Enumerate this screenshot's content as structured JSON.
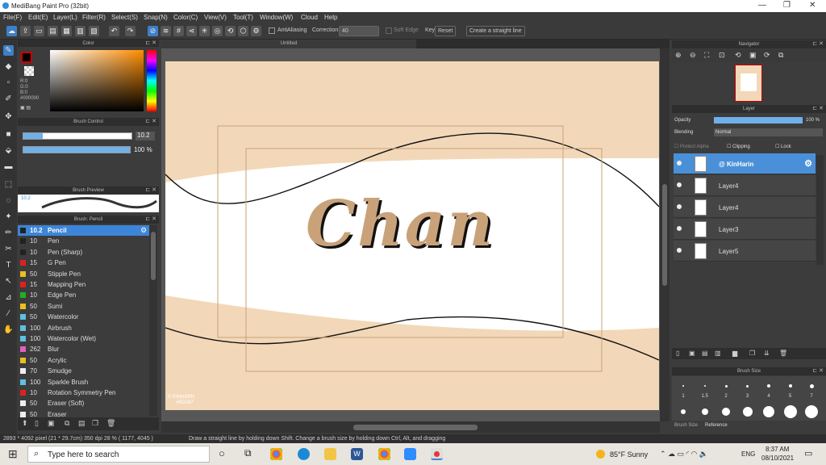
{
  "app": {
    "title": "MediBang Paint Pro (32bit)"
  },
  "menu": [
    "File(F)",
    "Edit(E)",
    "Layer(L)",
    "Filter(R)",
    "Select(S)",
    "Snap(N)",
    "Color(C)",
    "View(V)",
    "Tool(T)",
    "Window(W)",
    "Cloud",
    "Help"
  ],
  "toolbar": {
    "antialiasing": "AntiAliasing",
    "correction": "Correction",
    "correction_value": "40",
    "soft_edge": "Soft Edge",
    "key": "Key",
    "reset": "Reset",
    "straight_line": "Create a straight line"
  },
  "color_panel": {
    "title": "Color",
    "r": "R:0",
    "g": "G:0",
    "b": "B:0",
    "hex": "#000000"
  },
  "brush_control": {
    "title": "Brush Control",
    "size": "10.2",
    "opacity": "100 %"
  },
  "brush_preview": {
    "title": "Brush Preview",
    "size_label": "10.2"
  },
  "brush_list": {
    "title": "Brush: Pencil",
    "items": [
      {
        "size": "10.2",
        "name": "Pencil",
        "color": "#222222"
      },
      {
        "size": "10",
        "name": "Pen",
        "color": "#222222"
      },
      {
        "size": "10",
        "name": "Pen (Sharp)",
        "color": "#222222"
      },
      {
        "size": "15",
        "name": "G Pen",
        "color": "#e02020"
      },
      {
        "size": "50",
        "name": "Stipple Pen",
        "color": "#e8c020"
      },
      {
        "size": "15",
        "name": "Mapping Pen",
        "color": "#e02020"
      },
      {
        "size": "10",
        "name": "Edge Pen",
        "color": "#20b020"
      },
      {
        "size": "50",
        "name": "Sumi",
        "color": "#e8c020"
      },
      {
        "size": "50",
        "name": "Watercolor",
        "color": "#60c0e0"
      },
      {
        "size": "100",
        "name": "Airbrush",
        "color": "#60c0e0"
      },
      {
        "size": "100",
        "name": "Watercolor (Wet)",
        "color": "#60c0e0"
      },
      {
        "size": "262",
        "name": "Blur",
        "color": "#e060c0"
      },
      {
        "size": "50",
        "name": "Acrylic",
        "color": "#e8c020"
      },
      {
        "size": "70",
        "name": "Smudge",
        "color": "#eeeeee"
      },
      {
        "size": "100",
        "name": "Sparkle Brush",
        "color": "#60c0e0"
      },
      {
        "size": "10",
        "name": "Rotation Symmetry Pen",
        "color": "#e02020"
      },
      {
        "size": "50",
        "name": "Eraser (Soft)",
        "color": "#eeeeee"
      },
      {
        "size": "50",
        "name": "Eraser",
        "color": "#eeeeee"
      }
    ]
  },
  "canvas": {
    "tab": "Untitled",
    "lettering": "Chan",
    "watermark_line1": "© KINHARN",
    "watermark_line2": "#KD247"
  },
  "navigator": {
    "title": "Navigator"
  },
  "layer_panel": {
    "title": "Layer",
    "opacity_label": "Opacity",
    "opacity_value": "100 %",
    "blending_label": "Blending",
    "blending_value": "Normal",
    "protect_alpha": "Protect Alpha",
    "clipping": "Clipping",
    "lock": "Lock",
    "layers": [
      {
        "name": "@ KinHarin"
      },
      {
        "name": "Layer4"
      },
      {
        "name": "Layer4"
      },
      {
        "name": "Layer3"
      },
      {
        "name": "Layer5"
      }
    ]
  },
  "brush_size": {
    "title": "Brush Size",
    "labels": [
      "1",
      "1.5",
      "2",
      "3",
      "4",
      "5",
      "7"
    ],
    "tab1": "Brush Size",
    "tab2": "Reference"
  },
  "status": {
    "dims": "2893 * 4092 pixel  (21 * 29.7cm)  350 dpi  28 %  ( 1177, 4045 )",
    "hint": "Draw a straight line by holding down Shift. Change a brush size by holding down Ctrl, Alt, and dragging"
  },
  "taskbar": {
    "search": "Type here to search",
    "weather": "85°F  Sunny",
    "lang": "ENG",
    "time": "8:37 AM",
    "date": "08/10/2021"
  },
  "colors": {
    "accent": "#3d85d8",
    "canvas_bg": "#f2d8b8",
    "letter": "#c9a27a"
  }
}
